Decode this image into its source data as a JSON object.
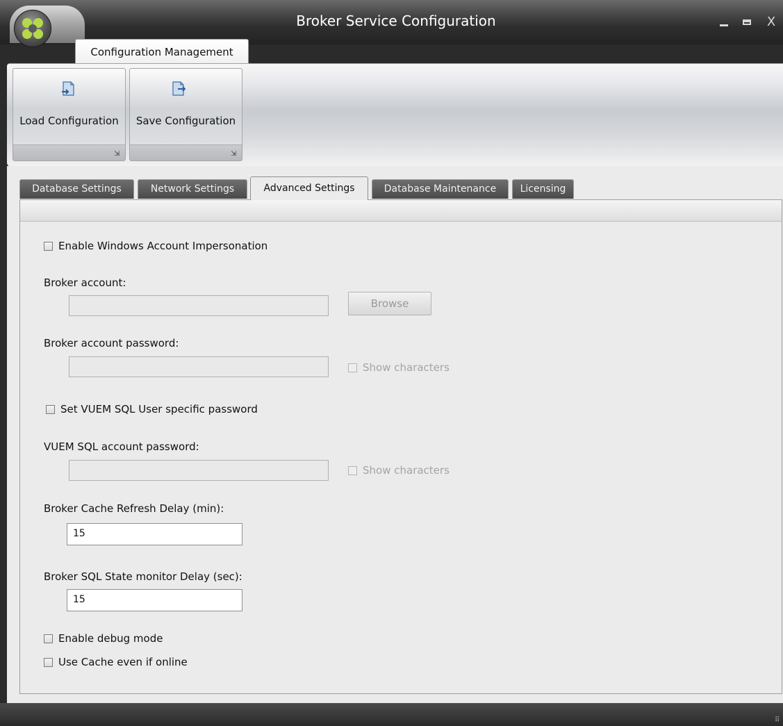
{
  "window": {
    "title": "Broker Service Configuration",
    "controls": {
      "minimize": "minimize-icon",
      "maximize": "maximize-icon",
      "close": "X"
    }
  },
  "ribbon": {
    "tab_label": "Configuration Management",
    "buttons": [
      {
        "label": "Load Configuration",
        "icon": "load-document-icon"
      },
      {
        "label": "Save Configuration",
        "icon": "save-document-icon"
      }
    ]
  },
  "tabs": [
    {
      "label": "Database Settings",
      "active": false
    },
    {
      "label": "Network Settings",
      "active": false
    },
    {
      "label": "Advanced Settings",
      "active": true
    },
    {
      "label": "Database Maintenance",
      "active": false
    },
    {
      "label": "Licensing",
      "active": false
    }
  ],
  "advanced": {
    "enable_impersonation": {
      "label": "Enable Windows Account Impersonation",
      "checked": false
    },
    "broker_account": {
      "label": "Broker account:",
      "value": "",
      "browse_label": "Browse"
    },
    "broker_password": {
      "label": "Broker account password:",
      "value": "",
      "show_chars": "Show characters"
    },
    "set_vuem_sql": {
      "label": "Set VUEM SQL User specific password",
      "checked": false
    },
    "vuem_sql_password": {
      "label": "VUEM SQL account password:",
      "value": "",
      "show_chars": "Show characters"
    },
    "cache_refresh": {
      "label": "Broker Cache Refresh Delay (min):",
      "value": "15"
    },
    "sql_state": {
      "label": "Broker SQL State monitor Delay (sec):",
      "value": "15"
    },
    "debug_mode": {
      "label": "Enable debug mode",
      "checked": false
    },
    "use_cache": {
      "label": "Use Cache even if online",
      "checked": false
    }
  },
  "colors": {
    "titlebar": "#2e2e2e",
    "client_bg": "#ebebeb",
    "inactive_tab": "#4a4a4a",
    "disabled_text": "#a4a4a4"
  }
}
